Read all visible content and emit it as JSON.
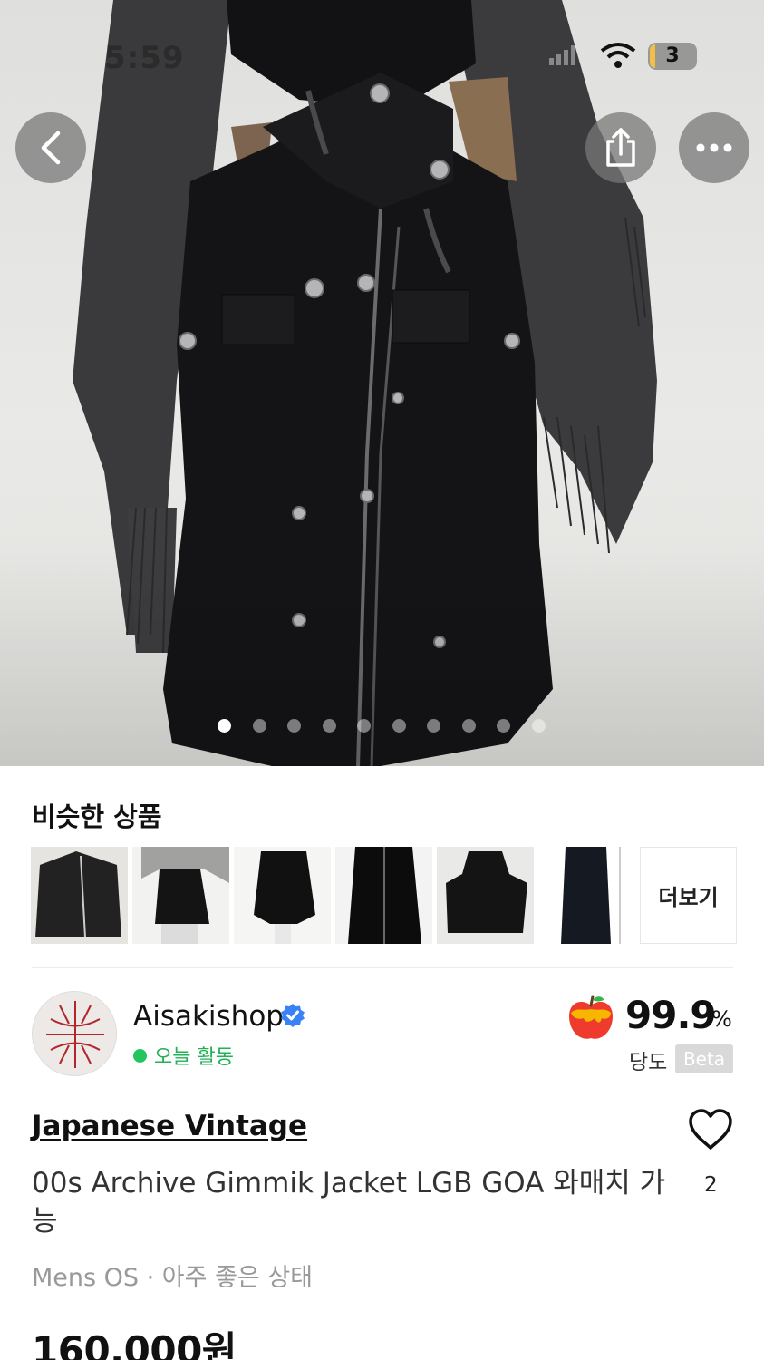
{
  "status_bar": {
    "time": "5:59",
    "battery": "3"
  },
  "hero": {
    "image_count": 10,
    "active_index": 0
  },
  "nav": {
    "back_icon": "chevron-left-icon",
    "share_icon": "share-icon",
    "more_icon": "more-horizontal-icon"
  },
  "similar": {
    "title": "비슷한 상품",
    "more_label": "더보기"
  },
  "seller": {
    "name": "Aisakishop",
    "activity": "오늘 활동",
    "score": "99.9",
    "score_unit": "%",
    "score_label": "당도",
    "beta": "Beta"
  },
  "product": {
    "brand": "Japanese Vintage",
    "title": "00s Archive Gimmik Jacket LGB GOA 와매치 가능",
    "meta": "Mens  OS · 아주 좋은 상태",
    "like_count": "2",
    "price": "160,000원"
  },
  "colors": {
    "accent_green": "#22c55e",
    "verified_blue": "#3b82f6"
  }
}
